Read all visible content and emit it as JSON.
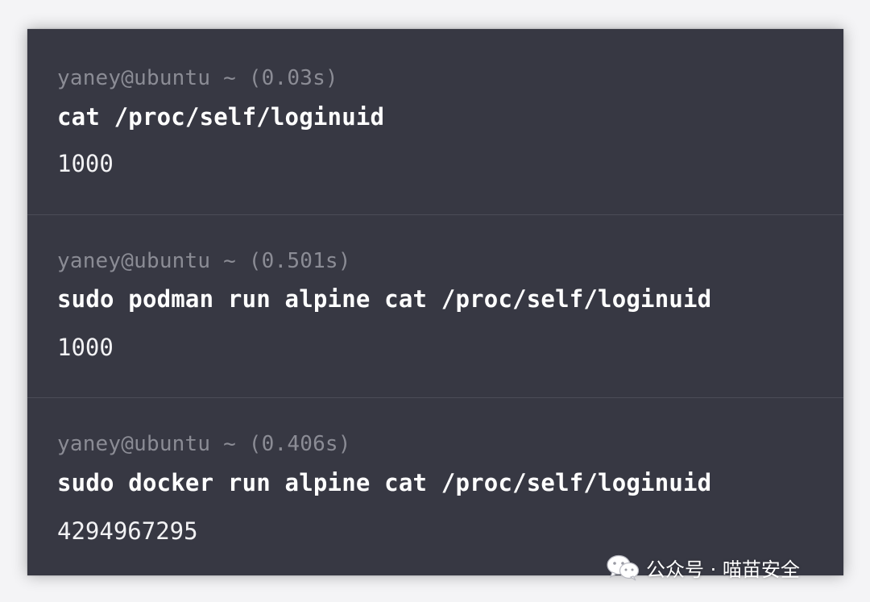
{
  "terminal_blocks": [
    {
      "prompt": "yaney@ubuntu ~ (0.03s)",
      "command": "cat /proc/self/loginuid",
      "output": "1000"
    },
    {
      "prompt": "yaney@ubuntu ~ (0.501s)",
      "command": "sudo podman run alpine cat /proc/self/loginuid",
      "output": "1000"
    },
    {
      "prompt": "yaney@ubuntu ~ (0.406s)",
      "command": "sudo docker run alpine cat /proc/self/loginuid",
      "output": "4294967295"
    }
  ],
  "watermark": {
    "icon": "wechat-icon",
    "text": "公众号 · 喵苗安全"
  },
  "colors": {
    "terminal_background": "#373843",
    "prompt_text": "#8b8c95",
    "command_text": "#ffffff",
    "divider": "#4c4d58"
  }
}
